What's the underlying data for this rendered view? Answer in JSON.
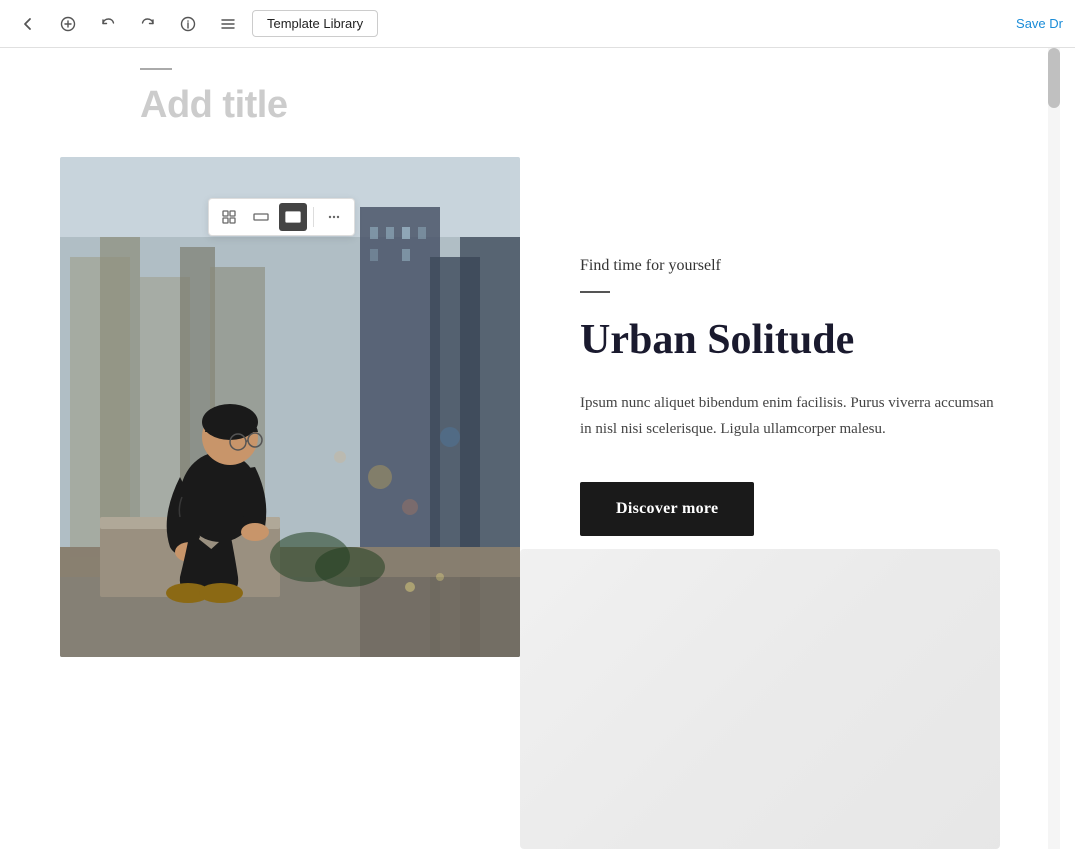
{
  "toolbar": {
    "template_library_label": "Template Library",
    "save_label": "Save Dr",
    "back_icon": "←",
    "add_icon": "+",
    "undo_icon": "↩",
    "redo_icon": "↪",
    "info_icon": "ℹ",
    "menu_icon": "☰"
  },
  "floating_toolbar": {
    "grid_icon": "⊞",
    "medium_icon": "▬",
    "large_icon": "▬",
    "more_icon": "⋯"
  },
  "page": {
    "title_placeholder": "Add title",
    "tagline": "Find time for yourself",
    "main_heading": "Urban Solitude",
    "body_text": "Ipsum nunc aliquet bibendum enim facilisis. Purus viverra accumsan in nisl nisi scelerisque. Ligula ullamcorper malesu.",
    "discover_btn": "Discover more"
  }
}
